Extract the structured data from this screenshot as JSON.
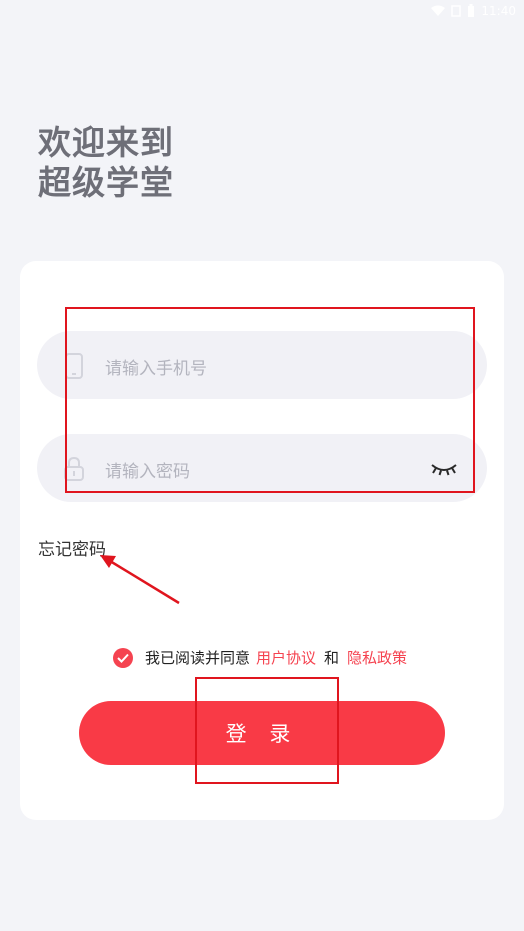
{
  "status_bar": {
    "time": "11:40",
    "icons": [
      "wifi-icon",
      "sim-icon",
      "battery-icon"
    ]
  },
  "heading": {
    "line1": "欢迎来到",
    "line2": "超级学堂"
  },
  "form": {
    "phone_placeholder": "请输入手机号",
    "password_placeholder": "请输入密码",
    "forgot_password": "忘记密码"
  },
  "agreement": {
    "checked": true,
    "prefix": "我已阅读并同意",
    "user_agreement": "用户协议",
    "and": "和",
    "privacy_policy": "隐私政策"
  },
  "login_button": {
    "label": "登 录"
  },
  "colors": {
    "accent": "#f93a46",
    "link": "#f54350",
    "background": "#f3f4f8",
    "annotation": "#e0151e"
  }
}
